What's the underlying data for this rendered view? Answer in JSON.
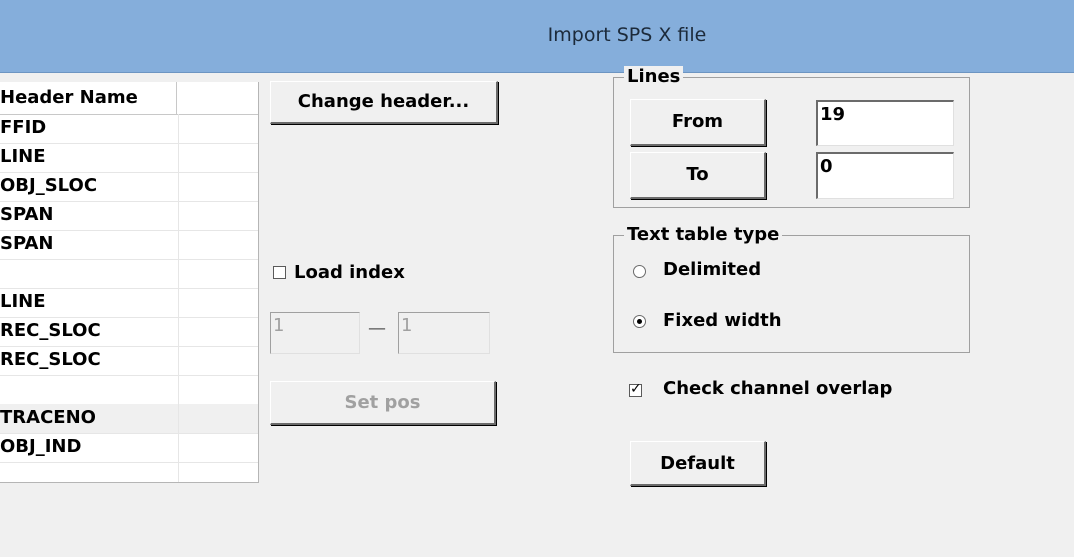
{
  "window": {
    "title": "Import SPS X file"
  },
  "list": {
    "header": "Header Name",
    "rows": [
      "FFID",
      "LINE",
      "OBJ_SLOC",
      "SPAN",
      "SPAN",
      "",
      "LINE",
      "REC_SLOC",
      "REC_SLOC",
      "",
      "TRACENO",
      "OBJ_IND",
      ""
    ]
  },
  "buttons": {
    "change_header": "Change header...",
    "set_pos": "Set pos",
    "from": "From",
    "to": "To",
    "default": "Default"
  },
  "load_index": {
    "label": "Load index",
    "checked": false,
    "start": "1",
    "end": "1",
    "dash": "—"
  },
  "lines": {
    "title": "Lines",
    "from_value": "19",
    "to_value": "0"
  },
  "text_table_type": {
    "title": "Text table type",
    "options": [
      "Delimited",
      "Fixed width"
    ],
    "selected": "Fixed width"
  },
  "check_overlap": {
    "label": "Check channel overlap",
    "checked": true
  }
}
